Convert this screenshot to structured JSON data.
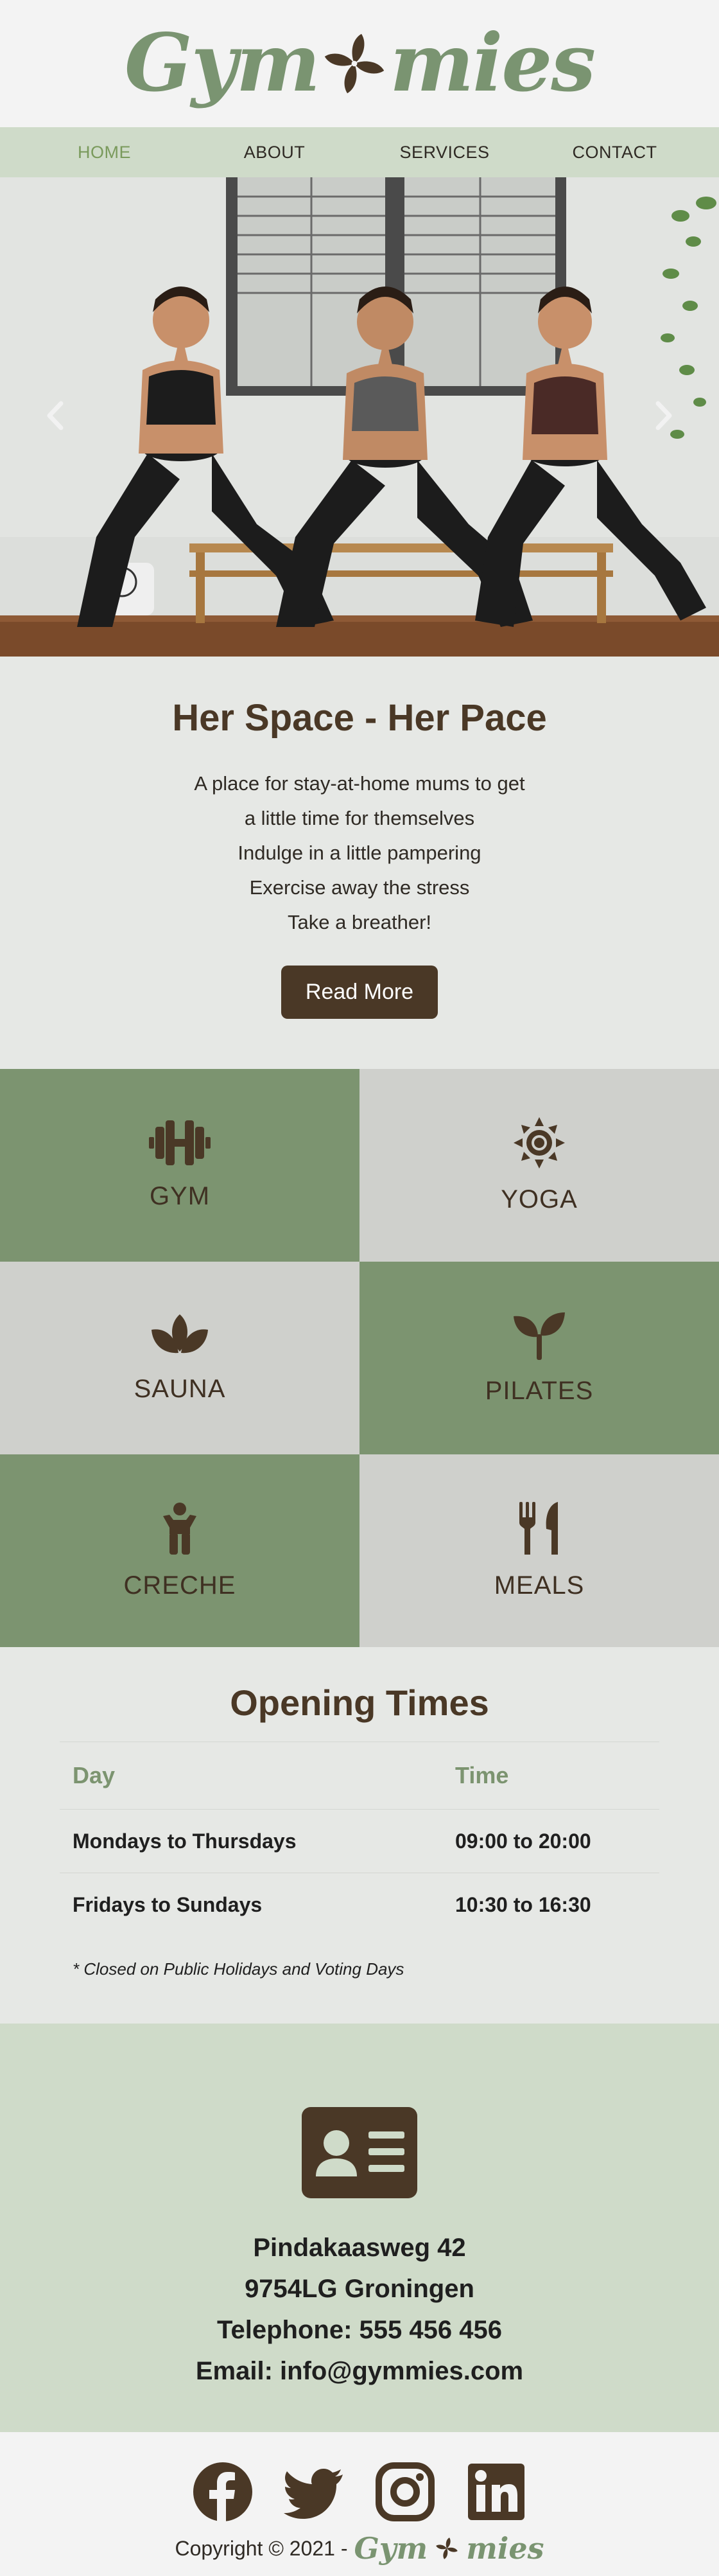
{
  "brand": {
    "name_left": "Gym",
    "name_right": "mies",
    "colors": {
      "green": "#7c9470",
      "brown": "#4a3826",
      "nav_bg": "#cfdbc9",
      "active_link": "#7a9a5c"
    }
  },
  "nav": {
    "items": [
      {
        "label": "HOME",
        "active": true
      },
      {
        "label": "ABOUT",
        "active": false
      },
      {
        "label": "SERVICES",
        "active": false
      },
      {
        "label": "CONTACT",
        "active": false
      }
    ]
  },
  "hero": {
    "image_alt": "Three women in a yoga squat pose with hands together",
    "prev_icon": "chevron-left-icon",
    "next_icon": "chevron-right-icon"
  },
  "intro": {
    "title": "Her Space - Her Pace",
    "lines": [
      "A place for stay-at-home mums to get",
      "a little time for themselves",
      "Indulge in a little pampering",
      "Exercise away the stress",
      "Take a breather!"
    ],
    "button": "Read More"
  },
  "services": [
    {
      "label": "GYM",
      "icon": "dumbbell-icon"
    },
    {
      "label": "YOGA",
      "icon": "sun-icon"
    },
    {
      "label": "SAUNA",
      "icon": "spa-icon"
    },
    {
      "label": "PILATES",
      "icon": "seedling-icon"
    },
    {
      "label": "CRECHE",
      "icon": "child-icon"
    },
    {
      "label": "MEALS",
      "icon": "utensils-icon"
    }
  ],
  "hours": {
    "title": "Opening Times",
    "headers": [
      "Day",
      "Time"
    ],
    "rows": [
      [
        "Mondays to Thursdays",
        "09:00 to 20:00"
      ],
      [
        "Fridays to Sundays",
        "10:30 to 16:30"
      ]
    ],
    "note": "* Closed on Public Holidays and Voting Days"
  },
  "contact": {
    "icon": "address-card-icon",
    "address": "Pindakaasweg 42",
    "city": "9754LG Groningen",
    "telephone": "Telephone: 555 456 456",
    "email": "Email: info@gymmies.com"
  },
  "footer": {
    "social": [
      "facebook-icon",
      "twitter-icon",
      "instagram-icon",
      "linkedin-icon"
    ],
    "copyright": "Copyright © 2021 -"
  }
}
